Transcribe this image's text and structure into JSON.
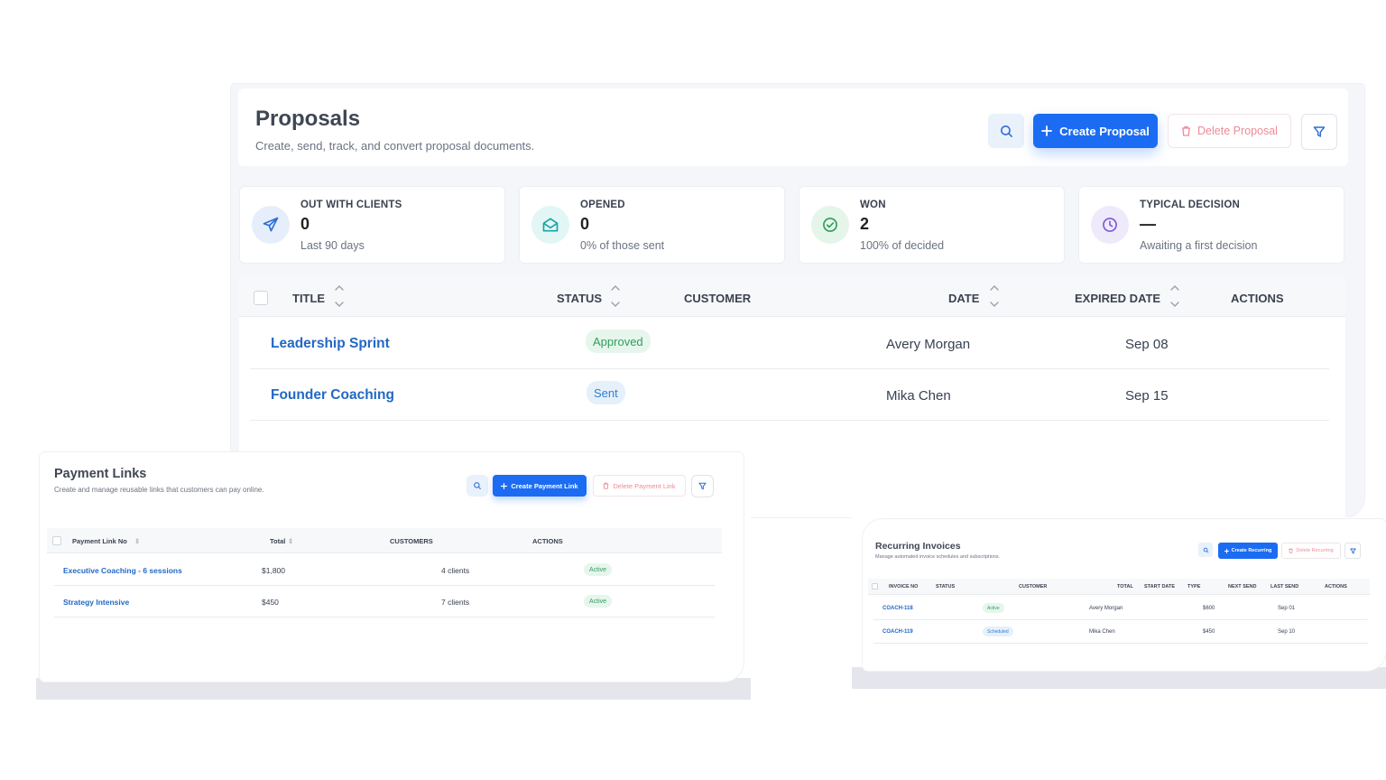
{
  "colors": {
    "accent": "#1b6cf2",
    "link": "#2368c4",
    "danger": "#ef8a97",
    "success": "#2f9e5b",
    "info": "#2f7fd1"
  },
  "proposals": {
    "title": "Proposals",
    "subtitle": "Create, send, track, and convert proposal documents.",
    "search_icon": "search-icon",
    "create_label": "Create Proposal",
    "delete_label": "Delete Proposal",
    "filter_icon": "filter-icon",
    "stats": [
      {
        "label": "OUT WITH CLIENTS",
        "value": "0",
        "note": "Last 90 days",
        "icon": "send-icon"
      },
      {
        "label": "OPENED",
        "value": "0",
        "note": "0% of those sent",
        "icon": "envelope-open-icon"
      },
      {
        "label": "WON",
        "value": "2",
        "note": "100% of decided",
        "icon": "check-circle-icon"
      },
      {
        "label": "TYPICAL DECISION",
        "value": "—",
        "note": "Awaiting a first decision",
        "icon": "clock-icon"
      }
    ],
    "columns": {
      "title": "TITLE",
      "status": "STATUS",
      "customer": "CUSTOMER",
      "date": "DATE",
      "expired": "EXPIRED DATE",
      "actions": "ACTIONS"
    },
    "rows": [
      {
        "title": "Leadership Sprint",
        "status": "Approved",
        "customer": "Avery Morgan",
        "date": "Sep 08"
      },
      {
        "title": "Founder Coaching",
        "status": "Sent",
        "customer": "Mika Chen",
        "date": "Sep 15"
      }
    ]
  },
  "payment_links": {
    "title": "Payment Links",
    "subtitle": "Create and manage reusable links that customers can pay online.",
    "create_label": "Create Payment Link",
    "delete_label": "Delete Payment Link",
    "columns": {
      "number": "Payment Link No",
      "total": "Total",
      "customers": "CUSTOMERS",
      "actions": "ACTIONS"
    },
    "rows": [
      {
        "name": "Executive Coaching - 6 sessions",
        "total": "$1,800",
        "customers": "4 clients",
        "status": "Active"
      },
      {
        "name": "Strategy Intensive",
        "total": "$450",
        "customers": "7 clients",
        "status": "Active"
      }
    ]
  },
  "recurring": {
    "title": "Recurring Invoices",
    "subtitle": "Manage automated invoice schedules and subscriptions.",
    "create_label": "Create Recurring",
    "delete_label": "Delete Recurring",
    "columns": {
      "invoice": "INVOICE NO",
      "status": "STATUS",
      "customer": "CUSTOMER",
      "total": "TOTAL",
      "start": "START DATE",
      "type": "TYPE",
      "next": "NEXT SEND",
      "last": "LAST SEND",
      "actions": "ACTIONS"
    },
    "rows": [
      {
        "invoice": "COACH-118",
        "status": "Active",
        "customer": "Avery Morgan",
        "total": "$600",
        "last": "Sep 01"
      },
      {
        "invoice": "COACH-119",
        "status": "Scheduled",
        "customer": "Mika Chen",
        "total": "$450",
        "last": "Sep 10"
      }
    ]
  }
}
